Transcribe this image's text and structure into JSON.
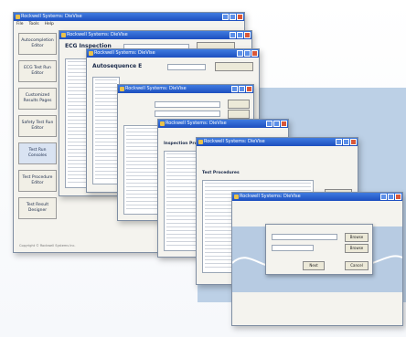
{
  "main_window": {
    "title": "Rockwell Systems: DieVise",
    "menu": [
      "File",
      "Tools",
      "Help"
    ],
    "sidebar_buttons": [
      "Autocompletion Editor",
      "ECG Test Run Editor",
      "Customized Results Pages",
      "Safety Test Run Editor",
      "Test Run Consoles",
      "Test Procedure Editor",
      "Test Result Designer"
    ],
    "active_sidebar_index": 4,
    "copyright": "Copyright © Rockwell Systems Inc."
  },
  "windows": [
    {
      "title": "Rockwell Systems: DieVise",
      "heading": "ECG Inspection"
    },
    {
      "title": "Rockwell Systems: DieVise",
      "heading": "Autosequence E"
    },
    {
      "title": "Rockwell Systems: DieVise",
      "heading": ""
    },
    {
      "title": "Rockwell Systems: DieVise",
      "heading": "Inspection Procedure"
    },
    {
      "title": "Rockwell Systems: DieVise",
      "heading": "Test Procedures"
    },
    {
      "title": "Rockwell Systems: DieVise",
      "heading": ""
    }
  ],
  "dialog": {
    "buttons": [
      "Browse",
      "Browse",
      "Next",
      "Cancel"
    ]
  },
  "colors": {
    "titlebar": "#1d4fbf",
    "window_bg": "#f4f3ee",
    "accent_blue": "#bcd0e6"
  }
}
